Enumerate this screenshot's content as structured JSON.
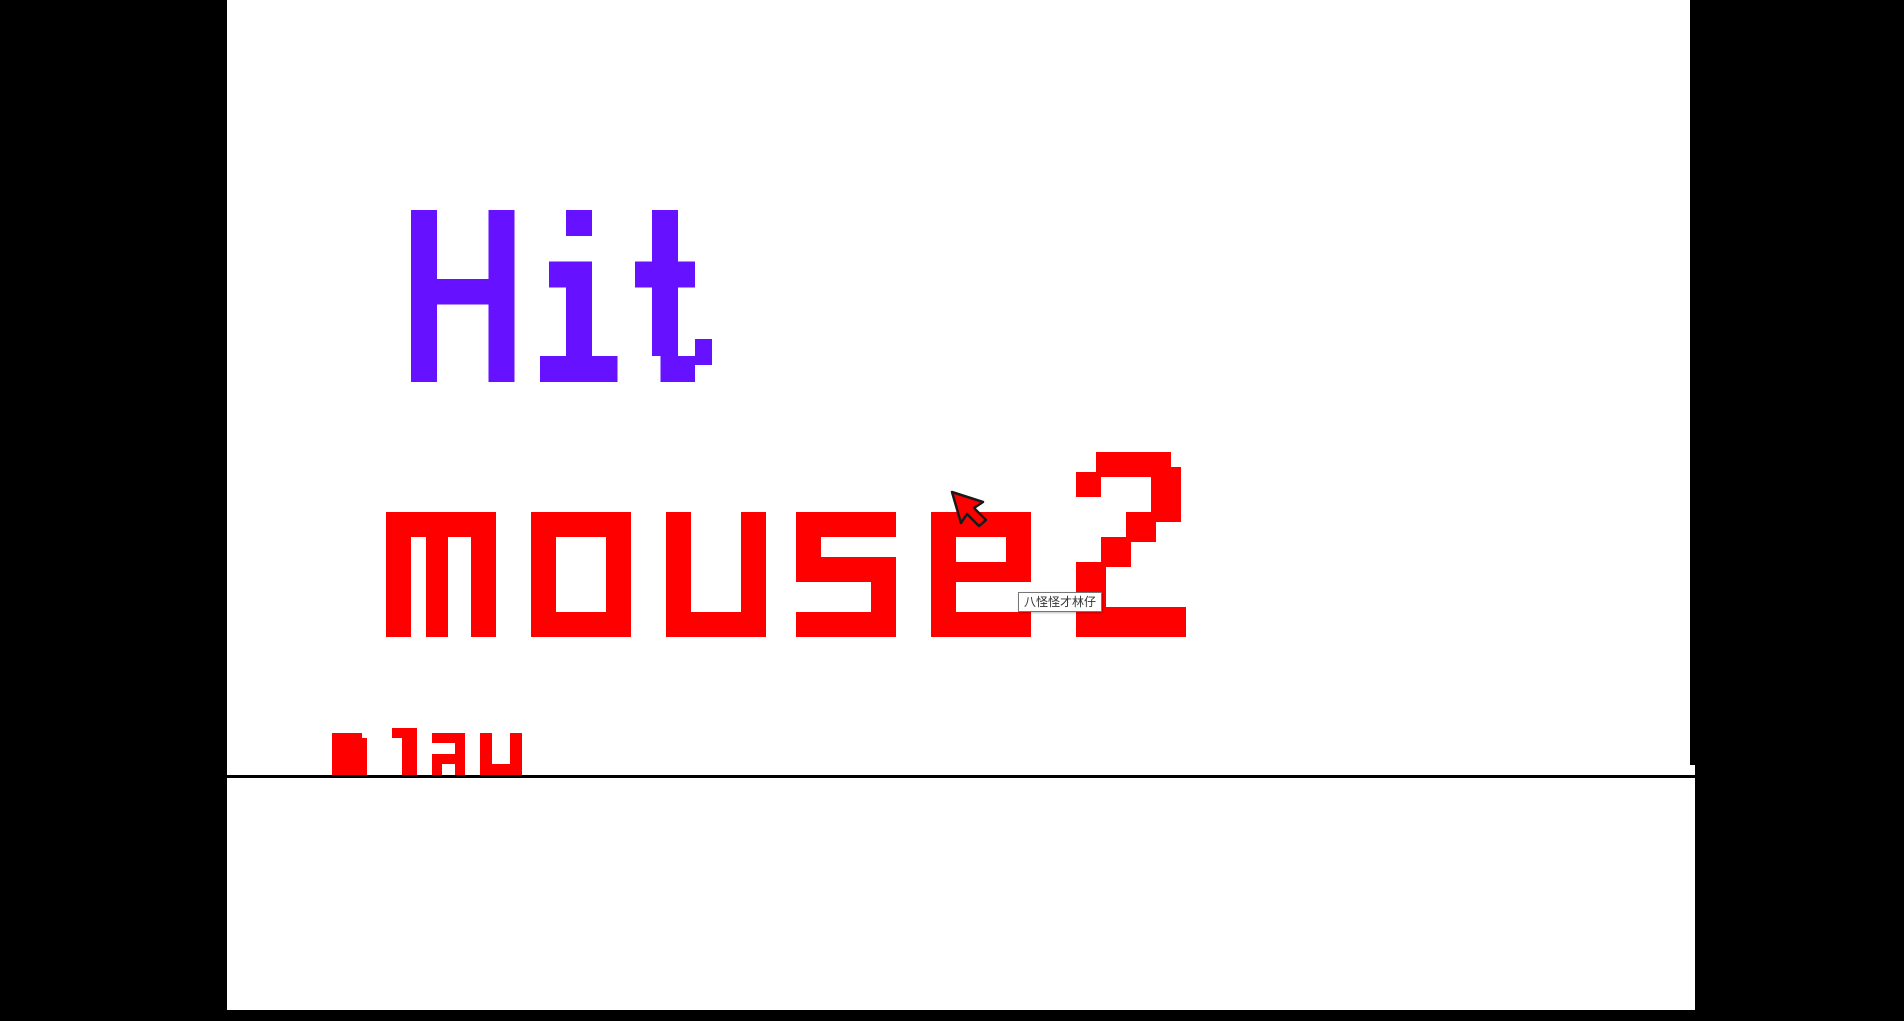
{
  "title": {
    "line1": "Hit",
    "line2_word": "mouse",
    "line2_number": "2",
    "line1_color": "#6611ff",
    "line2_color": "#ff0000"
  },
  "play_button": {
    "label": "play",
    "color": "#ff0000"
  },
  "tooltip": {
    "text": "八怪怪才林仔"
  },
  "cursor": {
    "icon": "arrow-cursor-icon",
    "fill": "#ff0000"
  },
  "colors": {
    "background": "#ffffff",
    "frame": "#000000"
  }
}
